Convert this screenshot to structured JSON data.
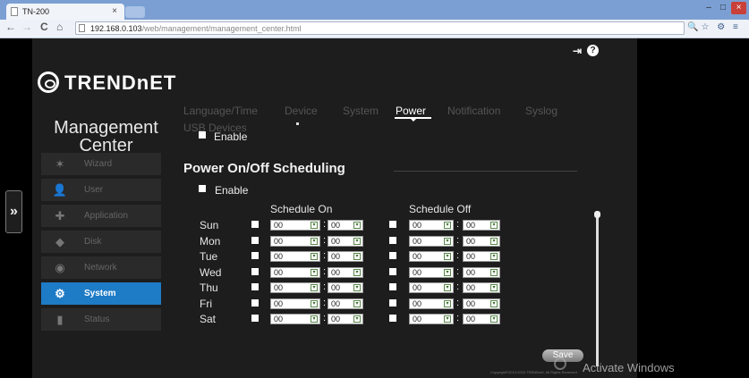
{
  "browser": {
    "tab_title": "TN-200",
    "tab_close": "×",
    "window_buttons": [
      "–",
      "□",
      "×"
    ],
    "nav": {
      "back": "←",
      "forward": "→",
      "reload": "C",
      "home": "⌂"
    },
    "url_host": "192.168.0.103",
    "url_path": "/web/management/management_center.html",
    "toolbar_icons": "🔍☆ ⚙ ≡"
  },
  "header": {
    "logo_text": "TRENDnET",
    "logout_icon": "⇥",
    "help_icon": "?"
  },
  "sidebar": {
    "title_line1": "Management",
    "title_line2": "Center",
    "expand_handle": "»",
    "items": [
      {
        "label": "Wizard",
        "icon": "✶"
      },
      {
        "label": "User",
        "icon": "👤"
      },
      {
        "label": "Application",
        "icon": "✚"
      },
      {
        "label": "Disk",
        "icon": "◆"
      },
      {
        "label": "Network",
        "icon": "◉"
      },
      {
        "label": "System",
        "icon": "⚙"
      },
      {
        "label": "Status",
        "icon": "▮"
      }
    ]
  },
  "tabs": {
    "items": [
      "Language/Time",
      "Device",
      "System",
      "Power",
      "Notification",
      "Syslog",
      "USB Devices"
    ],
    "active": "Power"
  },
  "top_enable_label": "Enable",
  "power": {
    "title": "Power On/Off Scheduling",
    "enable_label": "Enable",
    "schedule_on_label": "Schedule On",
    "schedule_off_label": "Schedule Off",
    "colon": ":",
    "days": [
      {
        "name": "Sun",
        "on_h": "00",
        "on_m": "00",
        "off_h": "00",
        "off_m": "00"
      },
      {
        "name": "Mon",
        "on_h": "00",
        "on_m": "00",
        "off_h": "00",
        "off_m": "00"
      },
      {
        "name": "Tue",
        "on_h": "00",
        "on_m": "00",
        "off_h": "00",
        "off_m": "00"
      },
      {
        "name": "Wed",
        "on_h": "00",
        "on_m": "00",
        "off_h": "00",
        "off_m": "00"
      },
      {
        "name": "Thu",
        "on_h": "00",
        "on_m": "00",
        "off_h": "00",
        "off_m": "00"
      },
      {
        "name": "Fri",
        "on_h": "00",
        "on_m": "00",
        "off_h": "00",
        "off_m": "00"
      },
      {
        "name": "Sat",
        "on_h": "00",
        "on_m": "00",
        "off_h": "00",
        "off_m": "00"
      }
    ],
    "save_label": "Save"
  },
  "footer": {
    "copyright": "Copyright©2013-2015 TRENDnet. All Rights Reserved."
  },
  "watermark": "Activate Windows",
  "colors": {
    "accent": "#1e7bc6",
    "panel": "#1d1d1d",
    "sidebar_item": "#2a2a2a"
  }
}
